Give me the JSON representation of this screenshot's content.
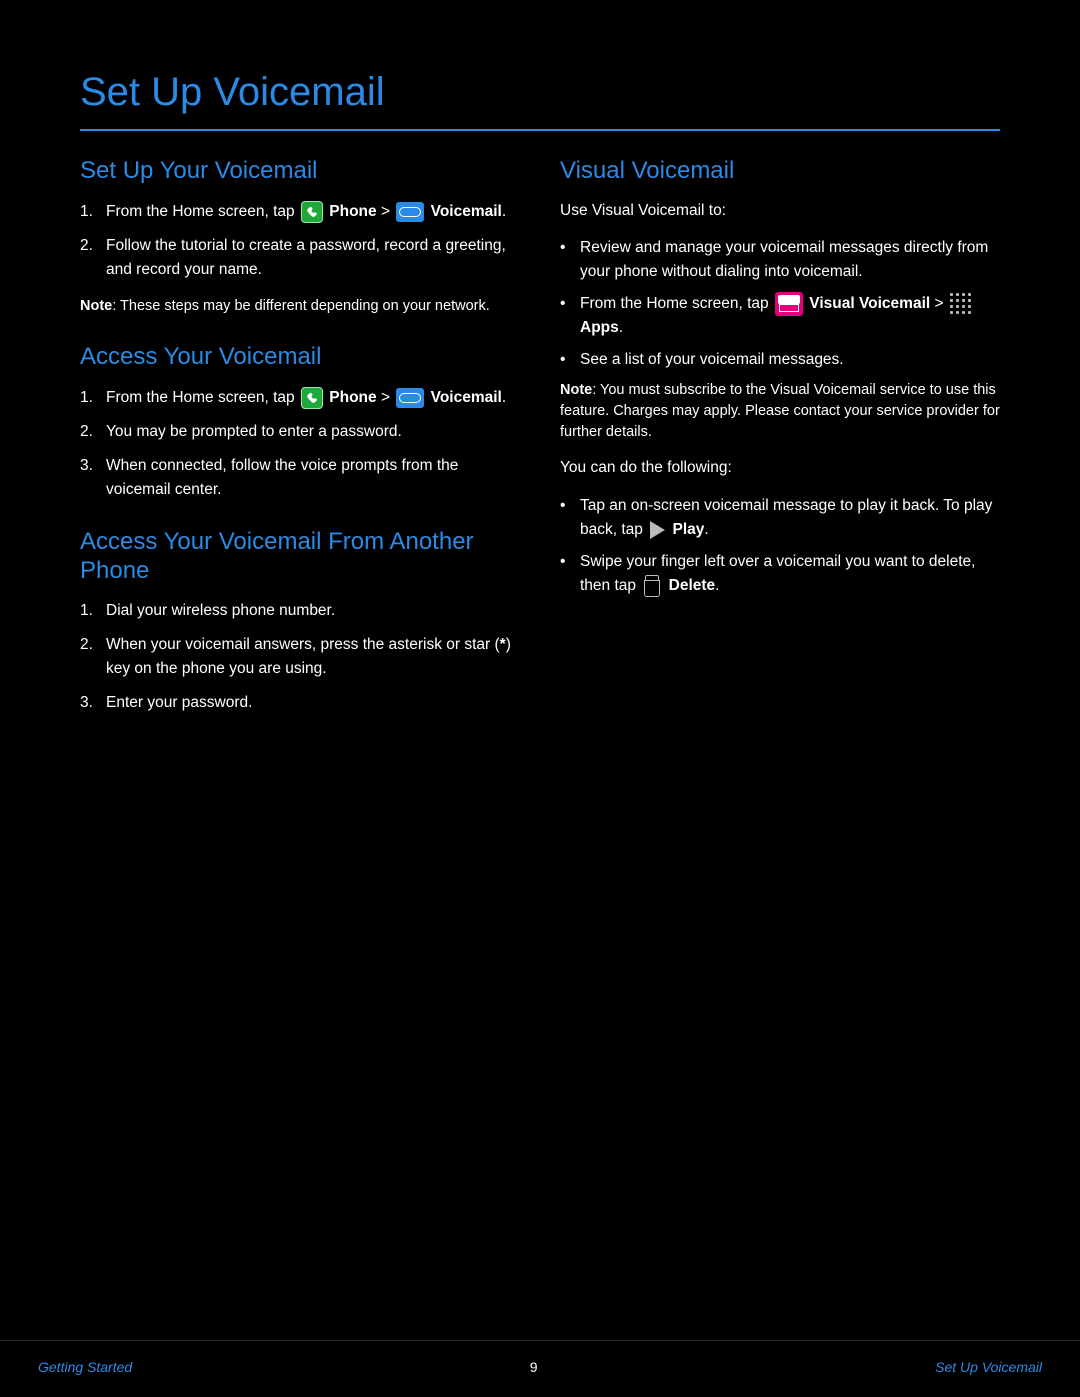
{
  "page_title": "Set Up Voicemail",
  "footer": {
    "left": "Getting Started",
    "center": "9",
    "right": "Set Up Voicemail"
  },
  "labels": {
    "note": "Note",
    "phone_btn": "Phone",
    "voicemail_btn": "Voicemail",
    "apps_btn": "Apps",
    "vv_btn": "Visual Voicemail",
    "play_btn": "Play",
    "delete_btn": "Delete"
  },
  "left_col": {
    "s1": {
      "heading": "Set Up Your Voicemail",
      "p1a": "From the Home screen, tap ",
      "p1b": " > ",
      "p1c": ".",
      "step2": "Follow the tutorial to create a password, record a greeting, and record your name.",
      "notetext": ": These steps may be different depending on your network."
    },
    "s2": {
      "heading": "Access Your Voicemail",
      "p1a": "From the Home screen, tap ",
      "p1b": " > ",
      "p1c": ".",
      "s2a": "You may be prompted to enter a password.",
      "s3": "When connected, follow the voice prompts from the voicemail center."
    },
    "s3": {
      "heading": "Access Your Voicemail From Another Phone",
      "st1": "Dial your wireless phone number.",
      "st2a": "When your voicemail answers, press the asterisk or star (",
      "st2b": ") key on the phone you are using.",
      "asterisk": "*",
      "st3": "Enter your password."
    }
  },
  "right_col": {
    "heading": "Visual Voicemail",
    "intro": "Use Visual Voicemail to:",
    "b1": "Review and manage your voicemail messages directly from your phone without dialing into voicemail.",
    "b2a": "From the Home screen, tap ",
    "b2b": " > ",
    "b2c": ".",
    "b3": "See a list of your voicemail messages.",
    "notetext": ": You must subscribe to the Visual Voicemail service to use this feature. Charges may apply. Please contact your service provider for further details.",
    "tasklead": "You can do the following:",
    "t1a": "Tap an on-screen voicemail message to play it back. To play back, tap ",
    "t1b": ".",
    "t2a": "Swipe your finger left over a voicemail you want to delete, then tap ",
    "t2b": "."
  }
}
